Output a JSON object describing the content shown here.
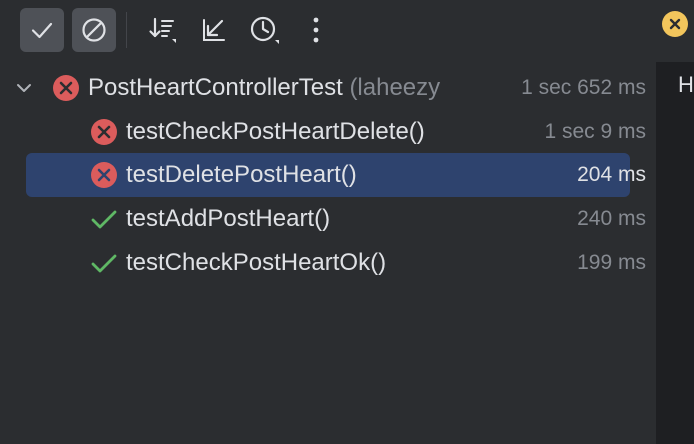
{
  "toolbar": {
    "buttons": [
      {
        "name": "show-passed-button",
        "icon": "checkmark-icon",
        "toggled": true
      },
      {
        "name": "show-ignored-button",
        "icon": "no-entry-icon",
        "toggled": true
      },
      {
        "name": "sort-button",
        "icon": "sort-icon",
        "toggled": false
      },
      {
        "name": "collapse-button",
        "icon": "arrow-down-left-icon",
        "toggled": false
      },
      {
        "name": "history-button",
        "icon": "clock-icon",
        "toggled": false
      },
      {
        "name": "more-options-button",
        "icon": "vertical-ellipsis-icon",
        "toggled": false
      }
    ]
  },
  "right_panel": {
    "peek_text": "H"
  },
  "tests": {
    "root": {
      "name": "PostHeartControllerTest",
      "context": "(laheezy",
      "duration": "1 sec 652 ms",
      "status": "failed",
      "expanded": true
    },
    "children": [
      {
        "name": "testCheckPostHeartDelete()",
        "duration": "1 sec 9 ms",
        "status": "failed",
        "selected": false
      },
      {
        "name": "testDeletePostHeart()",
        "duration": "204 ms",
        "status": "failed",
        "selected": true
      },
      {
        "name": "testAddPostHeart()",
        "duration": "240 ms",
        "status": "passed",
        "selected": false
      },
      {
        "name": "testCheckPostHeartOk()",
        "duration": "199 ms",
        "status": "passed",
        "selected": false
      }
    ]
  },
  "colors": {
    "background": "#2b2d30",
    "selection": "#2e436e",
    "failed": "#db5c5c",
    "passed": "#5fb865",
    "badge": "#f2c55c",
    "muted_text": "#868a91"
  }
}
